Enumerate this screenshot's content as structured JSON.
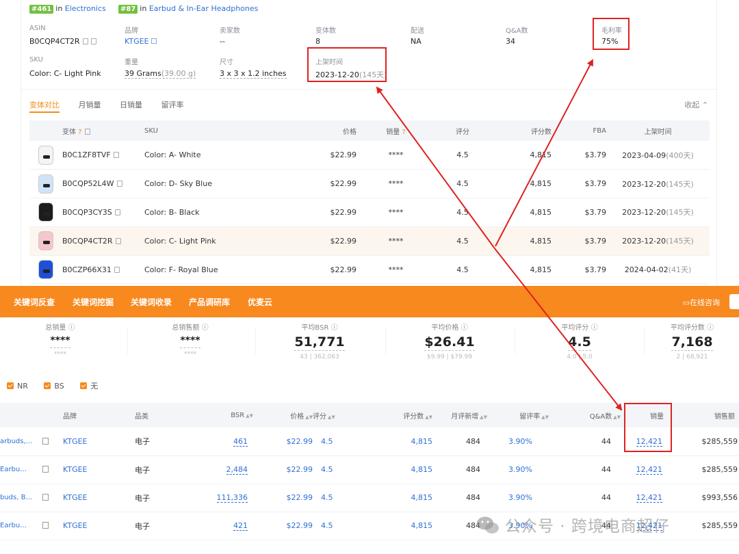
{
  "product": {
    "ranks": [
      {
        "badge": "#461",
        "in": "in",
        "category": "Electronics"
      },
      {
        "badge": "#87",
        "in": "in",
        "category": "Earbud & In-Ear Headphones"
      }
    ],
    "attributes": {
      "asin": {
        "label": "ASIN",
        "value": "B0CQP4CT2R"
      },
      "brand": {
        "label": "品牌",
        "value": "KTGEE"
      },
      "sellers": {
        "label": "卖家数",
        "value": "--"
      },
      "variants": {
        "label": "变体数",
        "value": "8"
      },
      "shipping": {
        "label": "配送",
        "value": "NA"
      },
      "qa": {
        "label": "Q&A数",
        "value": "34"
      },
      "margin": {
        "label": "毛利率",
        "value": "75%"
      },
      "sku": {
        "label": "SKU",
        "value": "Color: C- Light Pink"
      },
      "weight": {
        "label": "重量",
        "value": "39 Grams",
        "sub": "(39.00 g)"
      },
      "size": {
        "label": "尺寸",
        "value": "3 x 3 x 1.2 inches"
      },
      "listed": {
        "label": "上架时间",
        "value": "2023-12-20",
        "sub": "(145天)"
      }
    },
    "tabs": [
      "变体对比",
      "月销量",
      "日销量",
      "留评率"
    ],
    "collapse": "收起",
    "variant_headers": [
      "变体",
      "SKU",
      "价格",
      "销量",
      "评分",
      "评分数",
      "FBA",
      "上架时间"
    ],
    "variants": [
      {
        "asin": "B0C1ZF8TVF",
        "sku": "Color: A- White",
        "price": "$22.99",
        "sales": "****",
        "rating": "4.5",
        "reviews": "4,815",
        "fba": "$3.79",
        "date": "2023-04-09",
        "days": "(400天)",
        "color": "#f4f4f4"
      },
      {
        "asin": "B0CQP52L4W",
        "sku": "Color: D- Sky Blue",
        "price": "$22.99",
        "sales": "****",
        "rating": "4.5",
        "reviews": "4,815",
        "fba": "$3.79",
        "date": "2023-12-20",
        "days": "(145天)",
        "color": "#cfe4f7"
      },
      {
        "asin": "B0CQP3CY3S",
        "sku": "Color: B- Black",
        "price": "$22.99",
        "sales": "****",
        "rating": "4.5",
        "reviews": "4,815",
        "fba": "$3.79",
        "date": "2023-12-20",
        "days": "(145天)",
        "color": "#1c1c1c"
      },
      {
        "asin": "B0CQP4CT2R",
        "sku": "Color: C- Light Pink",
        "price": "$22.99",
        "sales": "****",
        "rating": "4.5",
        "reviews": "4,815",
        "fba": "$3.79",
        "date": "2023-12-20",
        "days": "(145天)",
        "color": "#f6c6cc"
      },
      {
        "asin": "B0CZP66X31",
        "sku": "Color: F- Royal Blue",
        "price": "$22.99",
        "sales": "****",
        "rating": "4.5",
        "reviews": "4,815",
        "fba": "$3.79",
        "date": "2024-04-02",
        "days": "(41天)",
        "color": "#1f4fd6"
      }
    ]
  },
  "nav": {
    "items": [
      "关键词反查",
      "关键词挖掘",
      "关键词收录",
      "产品调研库",
      "优麦云"
    ],
    "consult": "在线咨询"
  },
  "stats": [
    {
      "label": "总销量",
      "value": "****",
      "sub": "****"
    },
    {
      "label": "总销售额",
      "value": "****",
      "sub": "****"
    },
    {
      "label": "平均BSR",
      "value": "51,771",
      "sub": "43 | 362,063"
    },
    {
      "label": "平均价格",
      "value": "$26.41",
      "sub": "$9.99 | $79.99"
    },
    {
      "label": "平均评分",
      "value": "4.5",
      "sub": "4.0 | 5.0"
    },
    {
      "label": "平均评分数",
      "value": "7,168",
      "sub": "2 | 68,921"
    }
  ],
  "filters": [
    "NR",
    "BS",
    "无"
  ],
  "table_headers": [
    "品牌",
    "品类",
    "BSR",
    "价格",
    "评分",
    "评分数",
    "月评新增",
    "留评率",
    "Q&A数",
    "销量",
    "销售额"
  ],
  "rows": [
    {
      "title": "arbuds,...",
      "brand": "KTGEE",
      "cat": "电子",
      "bsr": "461",
      "price": "$22.99",
      "rating": "4.5",
      "reviews": "4,815",
      "monthly": "484",
      "rate": "3.90%",
      "qa": "44",
      "sales": "12,421",
      "revenue": "$285,559"
    },
    {
      "title": "Earbu...",
      "brand": "KTGEE",
      "cat": "电子",
      "bsr": "2,484",
      "price": "$22.99",
      "rating": "4.5",
      "reviews": "4,815",
      "monthly": "484",
      "rate": "3.90%",
      "qa": "44",
      "sales": "12,421",
      "revenue": "$285,559"
    },
    {
      "title": "buds, B...",
      "brand": "KTGEE",
      "cat": "电子",
      "bsr": "111,336",
      "price": "$22.99",
      "rating": "4.5",
      "reviews": "4,815",
      "monthly": "484",
      "rate": "3.90%",
      "qa": "44",
      "sales": "12,421",
      "revenue": "$993,556"
    },
    {
      "title": "Earbu...",
      "brand": "KTGEE",
      "cat": "电子",
      "bsr": "421",
      "price": "$22.99",
      "rating": "4.5",
      "reviews": "4,815",
      "monthly": "484",
      "rate": "3.90%",
      "qa": "44",
      "sales": "12,421",
      "revenue": "$285,559"
    }
  ],
  "watermark": "公众号 · 跨境电商超仔",
  "colors": {
    "accent": "#f7891f",
    "link": "#2f6fd6",
    "highlight": "#e02020",
    "badge": "#74c043"
  }
}
